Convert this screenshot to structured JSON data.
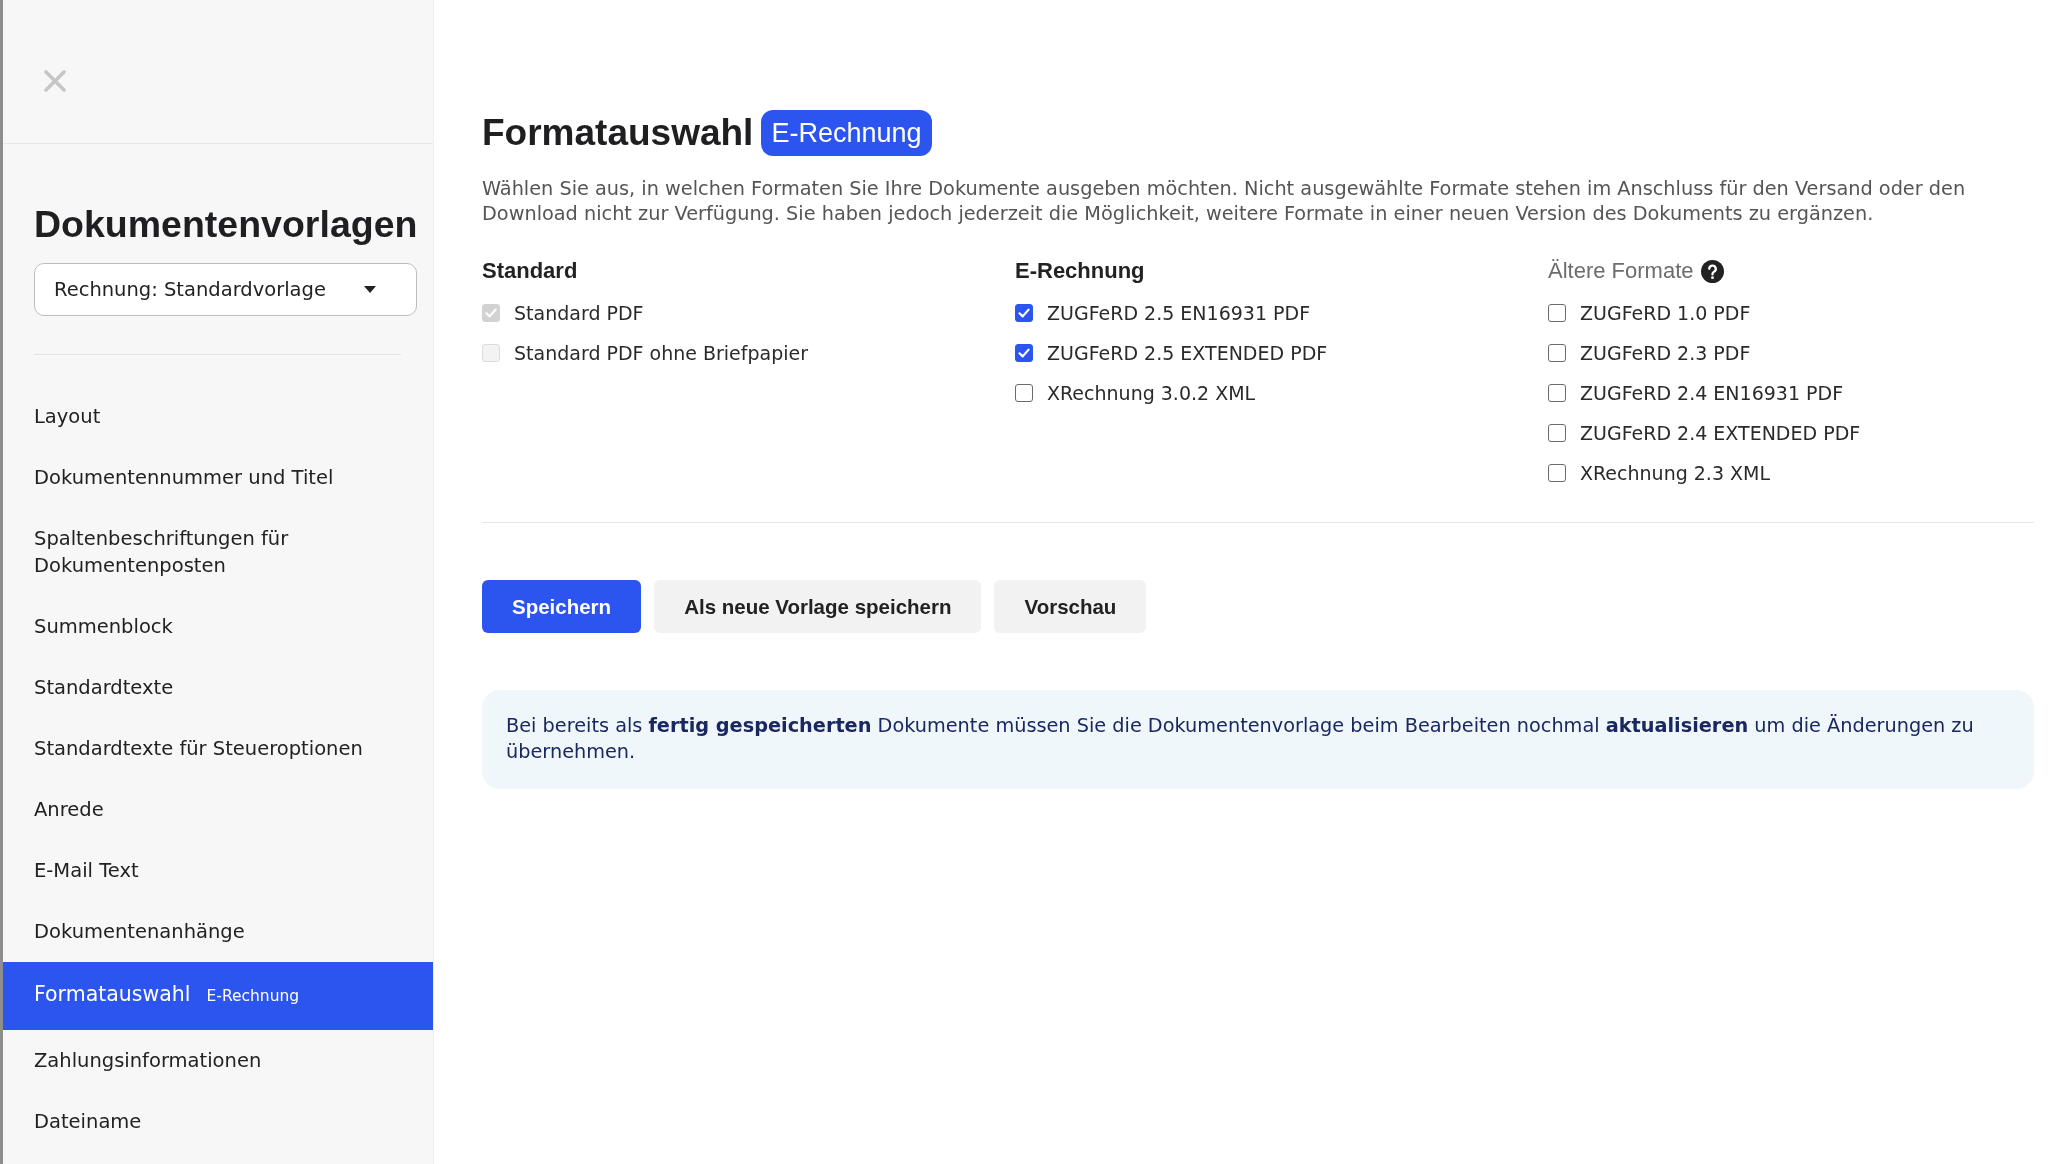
{
  "sidebar": {
    "title": "Dokumentenvorlagen",
    "template_select": {
      "value": "Rechnung: Standardvorlage"
    },
    "items": [
      {
        "label": "Layout",
        "selected": false
      },
      {
        "label": "Dokumentennummer und Titel",
        "selected": false
      },
      {
        "label": "Spaltenbeschriftungen für Dokumentenposten",
        "selected": false
      },
      {
        "label": "Summenblock",
        "selected": false
      },
      {
        "label": "Standardtexte",
        "selected": false
      },
      {
        "label": "Standardtexte für Steueroptionen",
        "selected": false
      },
      {
        "label": "Anrede",
        "selected": false
      },
      {
        "label": "E-Mail Text",
        "selected": false
      },
      {
        "label": "Dokumentenanhänge",
        "selected": false
      },
      {
        "label": "Formatauswahl",
        "badge": "E-Rechnung",
        "selected": true
      },
      {
        "label": "Zahlungsinformationen",
        "selected": false
      },
      {
        "label": "Dateiname",
        "selected": false
      }
    ]
  },
  "main": {
    "title": "Formatauswahl",
    "title_badge": "E-Rechnung",
    "description": "Wählen Sie aus, in welchen Formaten Sie Ihre Dokumente ausgeben möchten. Nicht ausgewählte Formate stehen im Anschluss für den Versand oder den Download nicht zur Verfügung. Sie haben jedoch jederzeit die Möglichkeit, weitere Formate in einer neuen Version des Dokuments zu ergänzen.",
    "groups": [
      {
        "heading": "Standard",
        "dimmed": false,
        "help": false,
        "options": [
          {
            "label": "Standard PDF",
            "checked": true,
            "disabled": true
          },
          {
            "label": "Standard PDF ohne Briefpapier",
            "checked": false,
            "disabled": true
          }
        ]
      },
      {
        "heading": "E-Rechnung",
        "dimmed": false,
        "help": false,
        "options": [
          {
            "label": "ZUGFeRD 2.5 EN16931 PDF",
            "checked": true,
            "disabled": false
          },
          {
            "label": "ZUGFeRD 2.5 EXTENDED PDF",
            "checked": true,
            "disabled": false
          },
          {
            "label": "XRechnung 3.0.2 XML",
            "checked": false,
            "disabled": false
          }
        ]
      },
      {
        "heading": "Ältere Formate",
        "dimmed": true,
        "help": true,
        "options": [
          {
            "label": "ZUGFeRD 1.0 PDF",
            "checked": false,
            "disabled": false
          },
          {
            "label": "ZUGFeRD 2.3 PDF",
            "checked": false,
            "disabled": false
          },
          {
            "label": "ZUGFeRD 2.4 EN16931 PDF",
            "checked": false,
            "disabled": false
          },
          {
            "label": "ZUGFeRD 2.4 EXTENDED PDF",
            "checked": false,
            "disabled": false
          },
          {
            "label": "XRechnung 2.3 XML",
            "checked": false,
            "disabled": false
          }
        ]
      }
    ],
    "buttons": [
      {
        "label": "Speichern",
        "kind": "primary"
      },
      {
        "label": "Als neue Vorlage speichern",
        "kind": "secondary"
      },
      {
        "label": "Vorschau",
        "kind": "secondary"
      }
    ],
    "notice": "Bei bereits als **fertig gespeicherten** Dokumente müssen Sie die Dokumentenvorlage beim Bearbeiten nochmal **aktualisieren** um die Änderungen zu übernehmen."
  }
}
